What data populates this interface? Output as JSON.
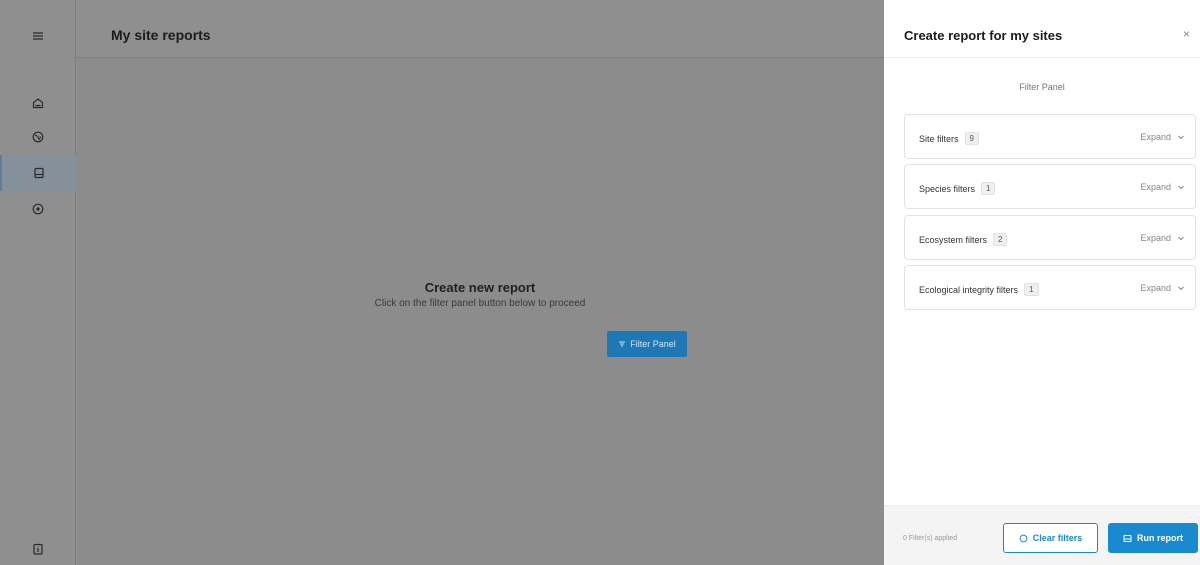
{
  "nav": {
    "menu_icon": "hamburger-icon",
    "items": [
      {
        "icon": "home-icon"
      },
      {
        "icon": "globe-icon"
      },
      {
        "icon": "report-icon",
        "active": true
      },
      {
        "icon": "compass-icon"
      }
    ],
    "bottom_icon": "help-doc-icon"
  },
  "header": {
    "title": "My site reports"
  },
  "main": {
    "empty_title": "Create new report",
    "empty_subtitle": "Click on the filter panel button below to proceed",
    "filter_button": "Filter Panel"
  },
  "drawer": {
    "title": "Create report for my sites",
    "close": "×",
    "panel_label": "Filter Panel",
    "filters": [
      {
        "label": "Site filters",
        "count": "9",
        "action": "Expand"
      },
      {
        "label": "Species filters",
        "count": "1",
        "action": "Expand"
      },
      {
        "label": "Ecosystem filters",
        "count": "2",
        "action": "Expand"
      },
      {
        "label": "Ecological integrity filters",
        "count": "1",
        "action": "Expand"
      }
    ],
    "footer": {
      "applied": "0 Filter(s) applied",
      "clear_label": "Clear filters",
      "run_label": "Run report"
    }
  },
  "colors": {
    "primary": "#1a8ad0",
    "overlay": "#8c8c8c"
  }
}
